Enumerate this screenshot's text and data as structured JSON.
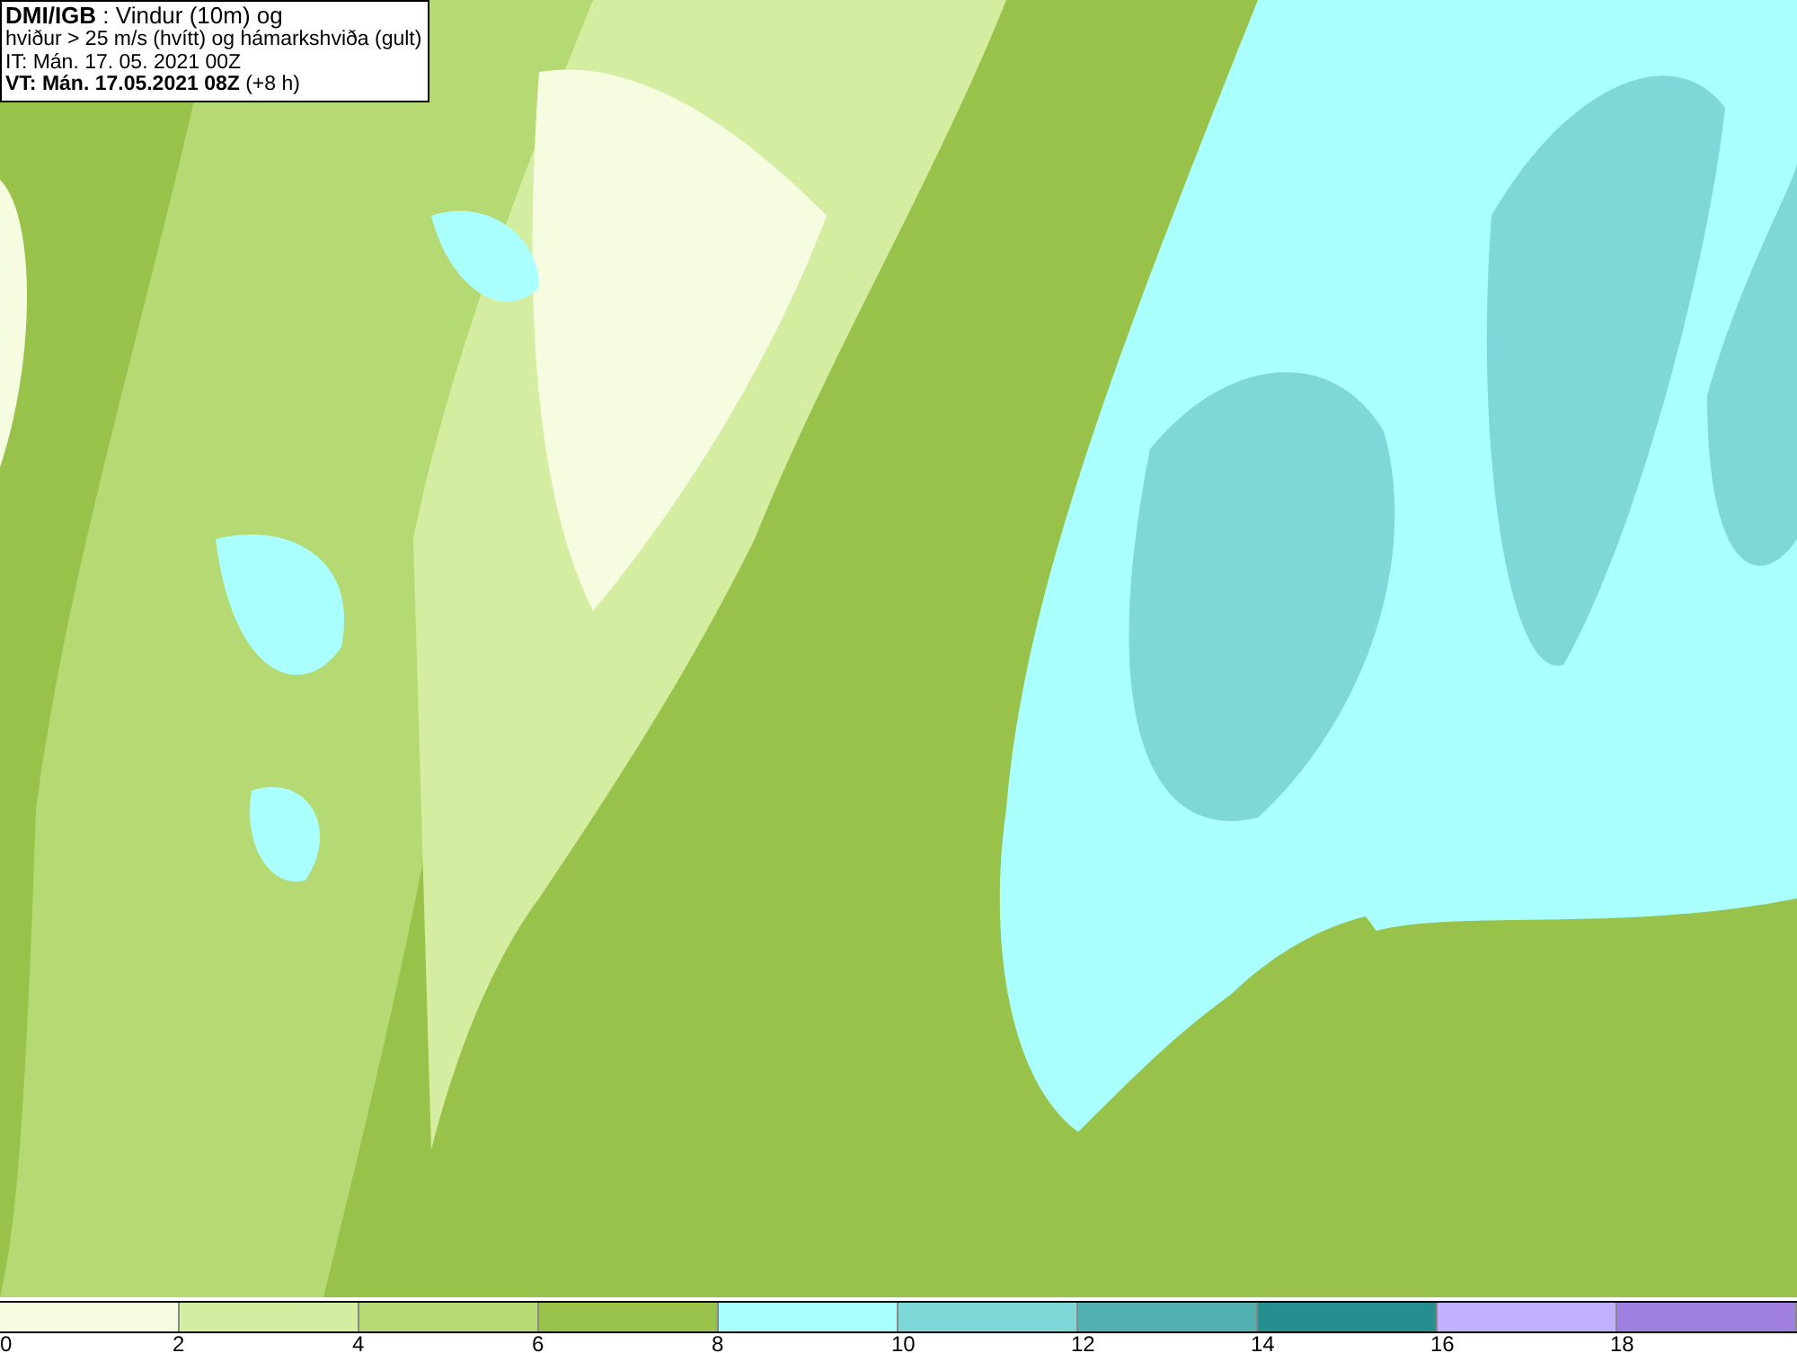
{
  "title_box": {
    "lines": [
      "**DMI/IGB** : Vindur (10m) og",
      "hviður > 25 m/s (hvítt) og hámarkshviða (gult)",
      "IT: Mán. 17. 05. 2021 00Z",
      "**VT: Mán. 17.05.2021 08Z** (+8 h)"
    ]
  },
  "legend": {
    "bins": [
      {
        "color": "#f5fce0"
      },
      {
        "color": "#d4eda0"
      },
      {
        "color": "#b5da73"
      },
      {
        "color": "#98c24a"
      },
      {
        "color": "#aaffff"
      },
      {
        "color": "#7fd8d8"
      },
      {
        "color": "#52b2b2"
      },
      {
        "color": "#258f8f"
      },
      {
        "color": "#c0b0ff"
      },
      {
        "color": "#9f80e0"
      }
    ],
    "ticks": [
      "0",
      "2",
      "4",
      "6",
      "8",
      "10",
      "12",
      "14",
      "16",
      "18"
    ]
  }
}
